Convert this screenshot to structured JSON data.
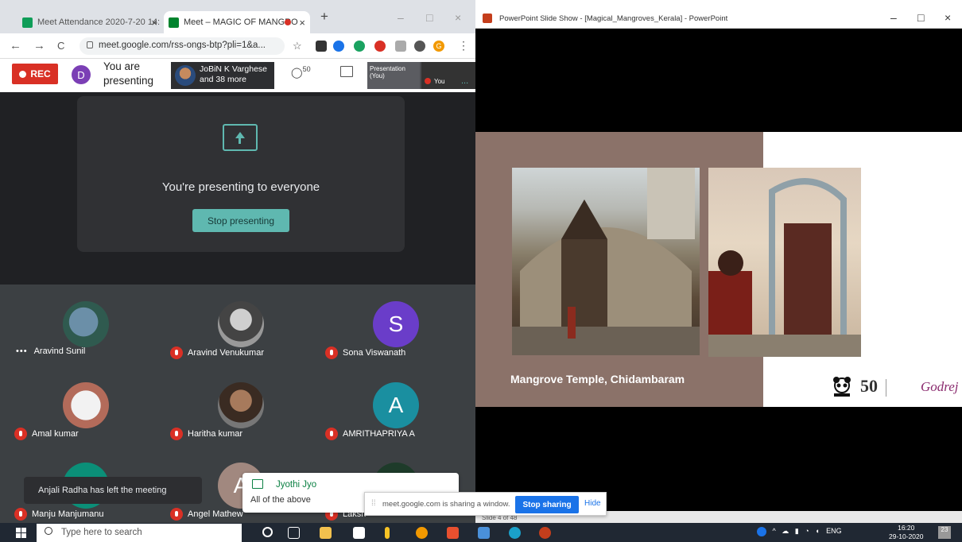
{
  "chrome": {
    "tabs": [
      {
        "label": "Meet Attendance 2020-7-20 14:",
        "active": false
      },
      {
        "label": "Meet – MAGIC OF MANGRO",
        "active": true
      }
    ],
    "new_tab": "+",
    "close": "×",
    "win_min": "–",
    "win_max": "□",
    "win_close": "×",
    "back": "←",
    "forward": "→",
    "reload": "C",
    "url": "meet.google.com/rss-ongs-btp?pli=1&a...",
    "menu": "⋮",
    "star": "☆",
    "profile": "G"
  },
  "meet": {
    "rec_label": "REC",
    "self_initial": "D",
    "presenting_label": "You are presenting",
    "presenter_name": "JoBiN K Varghese",
    "presenter_more": "and 38 more",
    "people_count": "50",
    "thumb_presentation": "Presentation (You)",
    "thumb_you": "You",
    "thumb_more": "...",
    "present_msg": "You're presenting to everyone",
    "stop_present_label": "Stop presenting",
    "participants": [
      {
        "name": "Aravind Sunil",
        "initial": "",
        "muted": false
      },
      {
        "name": "Aravind Venukumar",
        "initial": "",
        "muted": true
      },
      {
        "name": "Sona Viswanath",
        "initial": "S",
        "muted": true
      },
      {
        "name": "Amal kumar",
        "initial": "",
        "muted": true
      },
      {
        "name": "Haritha kumar",
        "initial": "",
        "muted": true
      },
      {
        "name": "AMRITHAPRIYA A",
        "initial": "A",
        "muted": true
      },
      {
        "name": "Manju Manjumanu",
        "initial": "",
        "muted": true
      },
      {
        "name": "Angel Mathew",
        "initial": "A",
        "muted": true
      },
      {
        "name": "Laksh",
        "initial": "",
        "muted": true
      }
    ],
    "toast": "Anjali Radha has left the meeting",
    "chat_sender": "Jyothi Jyo",
    "chat_message": "All of the above",
    "share_grip": "⁞⁞",
    "share_msg": "meet.google.com is sharing a window.",
    "stop_share_label": "Stop sharing",
    "hide_label": "Hide"
  },
  "ppt": {
    "title": "PowerPoint Slide Show - [Magical_Mangroves_Kerala] - PowerPoint",
    "win_min": "–",
    "win_max": "□",
    "win_close": "×",
    "slide_caption": "Mangrove Temple, Chidambaram",
    "logo_50": "50",
    "logo_brand": "Godrej",
    "slide_counter": "Slide 4 of 48"
  },
  "taskbar": {
    "search_placeholder": "Type here to search",
    "language": "ENG",
    "time": "16:20",
    "date": "29-10-2020",
    "notifications": "23"
  },
  "colors": {
    "meet_dark": "#202124",
    "accent_teal": "#5fb8b0",
    "rec_red": "#d93025",
    "slide_brown": "#8b7269",
    "share_blue": "#1a73e8"
  }
}
